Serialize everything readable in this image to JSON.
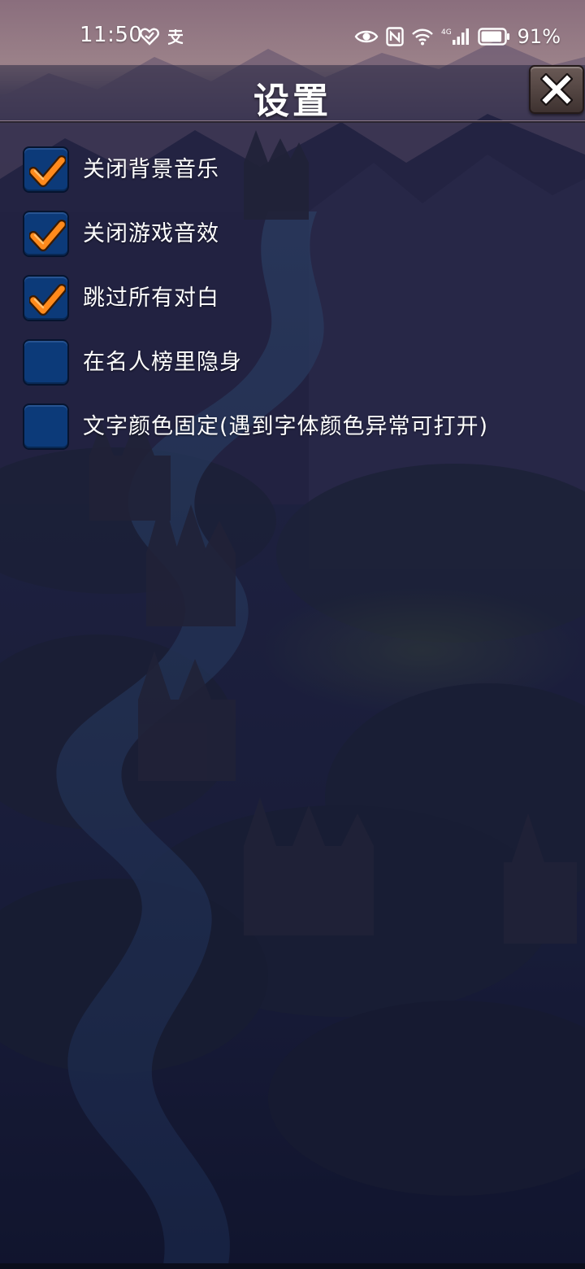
{
  "status_bar": {
    "time": "11:50",
    "battery_percent": "91%",
    "battery_level": 0.91,
    "left_icons": [
      "heart-check-icon",
      "alipay-icon"
    ],
    "right_icons": [
      "eye-icon",
      "nfc-icon",
      "wifi-icon",
      "signal-4g-icon",
      "battery-icon"
    ]
  },
  "header": {
    "title": "设置",
    "close_icon": "close-x-icon"
  },
  "settings": [
    {
      "label": "关闭背景音乐",
      "checked": true
    },
    {
      "label": "关闭游戏音效",
      "checked": true
    },
    {
      "label": "跳过所有对白",
      "checked": true
    },
    {
      "label": "在名人榜里隐身",
      "checked": false
    },
    {
      "label": "文字颜色固定(遇到字体颜色异常可打开)",
      "checked": false
    }
  ],
  "colors": {
    "checkbox_fill": "#0c3a79",
    "checkmark": "#ff8a1c",
    "overlay": "#1a1f45"
  }
}
